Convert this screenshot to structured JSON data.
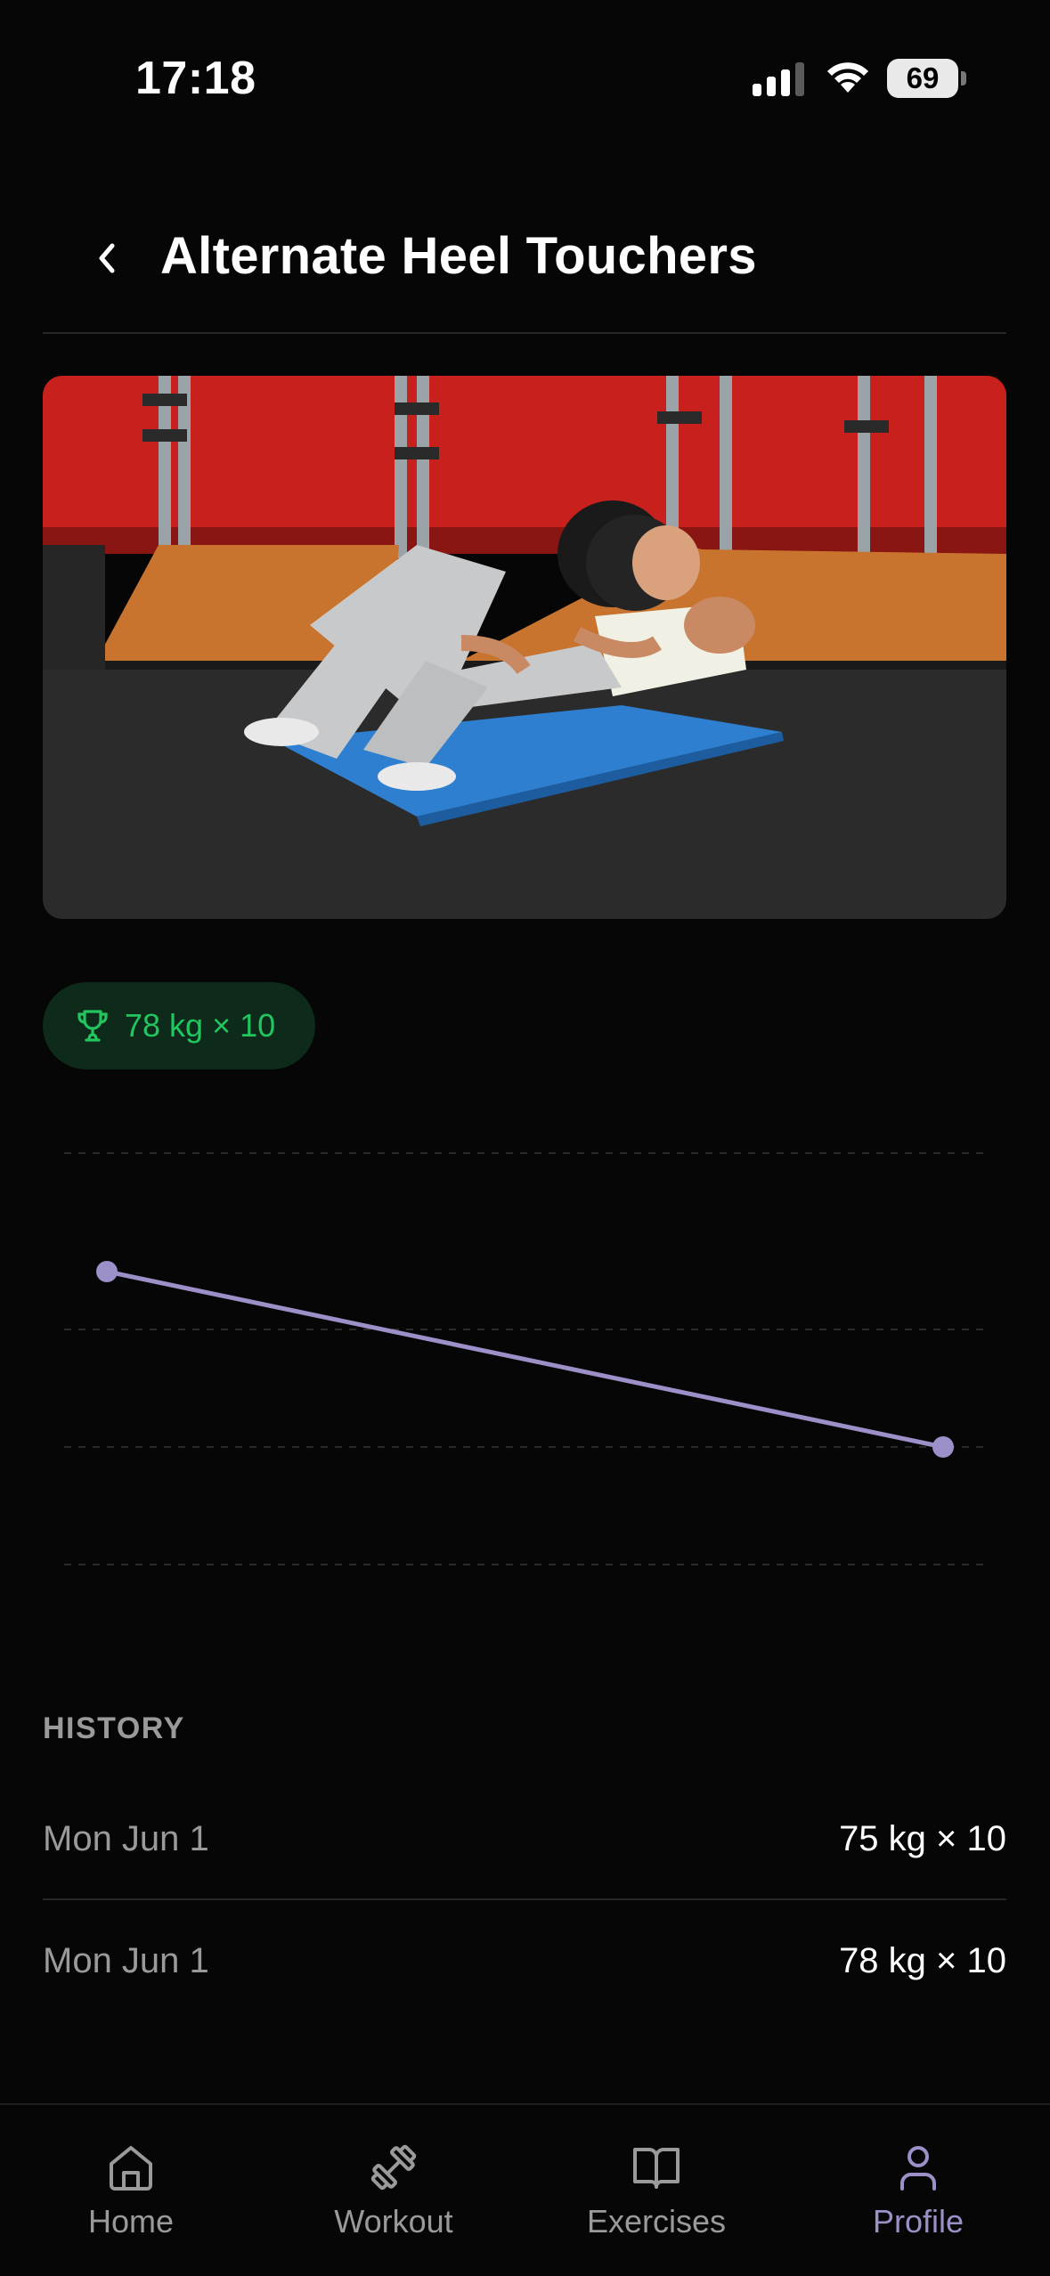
{
  "status_bar": {
    "time": "17:18",
    "battery": "69"
  },
  "header": {
    "back_icon": "chevron-left-icon",
    "title": "Alternate Heel Touchers"
  },
  "hero_image": {
    "description_icon": "exercise-photo"
  },
  "personal_record": {
    "icon": "trophy-icon",
    "label": "78 kg × 10",
    "color": "#22c55e",
    "background": "#0d2a1b"
  },
  "chart_data": {
    "type": "line",
    "title": "",
    "xlabel": "",
    "ylabel": "",
    "grid": true,
    "series": [
      {
        "values": [
          78,
          75
        ]
      }
    ],
    "line_color": "#9d8fc7"
  },
  "history": {
    "heading": "HISTORY",
    "rows": [
      {
        "date": "Mon Jun 1",
        "value": "75 kg × 10"
      },
      {
        "date": "Mon Jun 1",
        "value": "78 kg × 10"
      }
    ]
  },
  "tab_bar": {
    "active": "Profile",
    "accent_color": "#9d8fc7",
    "tabs": [
      {
        "label": "Home",
        "icon": "home-icon"
      },
      {
        "label": "Workout",
        "icon": "dumbbell-icon"
      },
      {
        "label": "Exercises",
        "icon": "book-icon"
      },
      {
        "label": "Profile",
        "icon": "user-icon"
      }
    ]
  }
}
